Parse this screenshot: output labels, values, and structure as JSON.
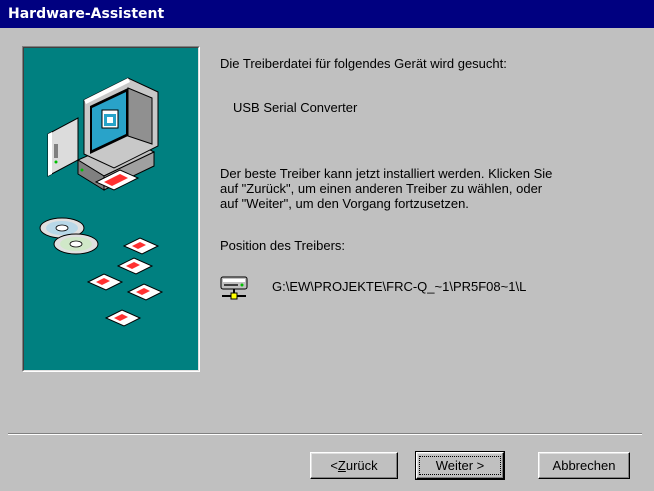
{
  "window": {
    "title": "Hardware-Assistent"
  },
  "content": {
    "heading": "Die Treiberdatei für folgendes Gerät wird gesucht:",
    "device_name": "USB Serial Converter",
    "description_lines": [
      "Der beste Treiber kann jetzt installiert werden. Klicken Sie",
      "auf \"Zurück\", um einen anderen Treiber zu wählen, oder",
      "auf \"Weiter\", um den Vorgang fortzusetzen."
    ],
    "driver_location_label": "Position des Treibers:",
    "driver_path": "G:\\EW\\PROJEKTE\\FRC-Q_~1\\PR5F08~1\\L",
    "driver_icon": "network-drive-icon"
  },
  "buttons": {
    "back": {
      "prefix": "< ",
      "mnemonic": "Z",
      "rest": "urück"
    },
    "next": {
      "label": "Weiter >"
    },
    "cancel": {
      "label": "Abbrechen"
    }
  },
  "colors": {
    "titlebar": "#000080",
    "panel_background": "#008080",
    "dialog_background": "#c0c0c0"
  },
  "illustration": {
    "icons": [
      "computer-icon",
      "cd-disc-icon",
      "floppy-disk-icon"
    ]
  }
}
